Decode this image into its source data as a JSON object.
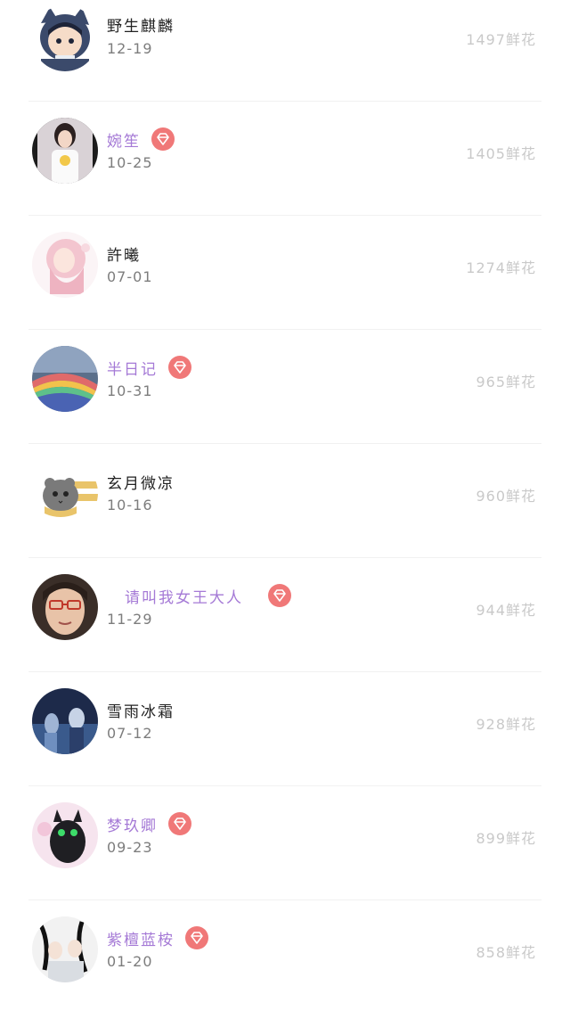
{
  "colors": {
    "vip_name": "#a57ad6",
    "normal_name": "#222222",
    "date": "#7d7d7d",
    "flowers": "#c9c9c9",
    "vip_badge": "#f07878"
  },
  "list": {
    "items": [
      {
        "name": "野生麒麟",
        "date": "12-19",
        "flowers": "1497鲜花",
        "vip": false
      },
      {
        "name": "婉笙",
        "date": "10-25",
        "flowers": "1405鲜花",
        "vip": true
      },
      {
        "name": "許曦",
        "date": "07-01",
        "flowers": "1274鲜花",
        "vip": false
      },
      {
        "name": "半日记",
        "date": "10-31",
        "flowers": "965鲜花",
        "vip": true
      },
      {
        "name": "玄月微凉",
        "date": "10-16",
        "flowers": "960鲜花",
        "vip": false
      },
      {
        "name": "请叫我女王大人",
        "date": "11-29",
        "flowers": "944鲜花",
        "vip": true
      },
      {
        "name": "雪雨冰霜",
        "date": "07-12",
        "flowers": "928鲜花",
        "vip": false
      },
      {
        "name": "梦玖卿",
        "date": "09-23",
        "flowers": "899鲜花",
        "vip": true
      },
      {
        "name": "紫檀蓝桉",
        "date": "01-20",
        "flowers": "858鲜花",
        "vip": true
      }
    ],
    "vip_icon": "diamond-icon"
  }
}
